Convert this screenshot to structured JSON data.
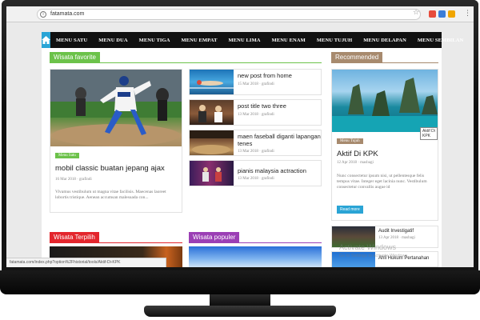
{
  "browser": {
    "url": "fatamata.com",
    "info_glyph": "i",
    "star_glyph": "☆",
    "menu_glyph": "⋮",
    "status_url": "fatamata.com/index.php?option%2Fhistorial/tools/Aktif-Di-KPK"
  },
  "nav": {
    "items": [
      "MENU SATU",
      "MENU DUA",
      "MENU TIGA",
      "MENU EMPAT",
      "MENU LIMA",
      "MENU ENAM",
      "MENU TUJUH",
      "MENU DELAPAN",
      "MENU SEMBILAN"
    ]
  },
  "favorite": {
    "title": "Wisata favorite",
    "color": "#6cc24a",
    "main": {
      "tag": "Menu Satu",
      "headline": "mobil classic buatan jepang ajax",
      "meta": "16 Mar 2018  ·  grafindi",
      "excerpt": "Vivamus vestibulum ut magna vitae facilisis. Maecenas laoreet lobortis tristique. Aenean accumsan malesuada con..."
    },
    "list": [
      {
        "title": "new post from home",
        "meta": "15 Mar 2018  ·  grafindi"
      },
      {
        "title": "post title two three",
        "meta": "13 Mar 2018  ·  grafindi"
      },
      {
        "title": "maen faseball diganti lapangan tenes",
        "meta": "13 Mar 2018  ·  grafindi"
      },
      {
        "title": "pianis malaysia actraction",
        "meta": "13 Mar 2018  ·  grafindi"
      }
    ]
  },
  "recommended": {
    "title": "Recommended",
    "color": "#a78a6e",
    "tag": "Menu Tujuh",
    "tooltip": "Aktif Di KPK",
    "headline": "Aktif Di KPK",
    "meta": "12 Apr 2018  ·  masbagi",
    "excerpt": "Nunc consectetur ipsum nisi, ut pellentesque felis tempus vitae. Integer eget lacinia nunc. Vestibulum consectetur convallis augue id",
    "read_more": "Read more",
    "list": [
      {
        "title": "Audit Investigatif",
        "meta": "13 Apr 2018  ·  masbagi"
      },
      {
        "title": "Ahli Hukum Pertanahan",
        "meta": "13 Apr 2018  ·  masbagi"
      }
    ]
  },
  "terpilih": {
    "title": "Wisata Terpilih",
    "color": "#e3262d"
  },
  "populer": {
    "title": "Wisata populer",
    "color": "#9b3fb5"
  },
  "watermark": {
    "line1": "Activate Windows",
    "line2": "Go to Settings to activate Windows."
  }
}
